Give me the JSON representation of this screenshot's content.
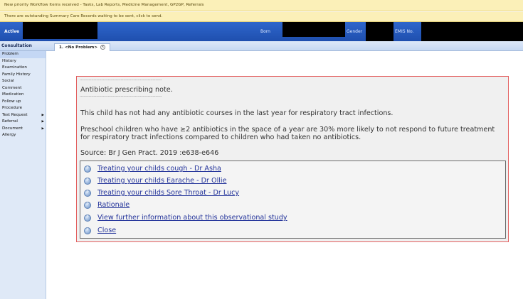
{
  "notifications": {
    "workflow": "New priority Workflow Items received - Tasks, Lab Reports, Medicine Management, GP2GP, Referrals",
    "summary_care": "There are outstanding Summary Care Records waiting to be sent, click to send."
  },
  "patient_bar": {
    "status": "Active",
    "born_label": "Born",
    "gender_label": "Gender",
    "emis_label": "EMIS No."
  },
  "consultation": {
    "title": "Consultation",
    "tab_label": "1. <No Problem>"
  },
  "sidebar": {
    "items": [
      {
        "label": "Problem",
        "has_submenu": false
      },
      {
        "label": "History",
        "has_submenu": false
      },
      {
        "label": "Examination",
        "has_submenu": false
      },
      {
        "label": "Family History",
        "has_submenu": false
      },
      {
        "label": "Social",
        "has_submenu": false
      },
      {
        "label": "Comment",
        "has_submenu": false
      },
      {
        "label": "Medication",
        "has_submenu": false
      },
      {
        "label": "Follow up",
        "has_submenu": false
      },
      {
        "label": "Procedure",
        "has_submenu": false
      },
      {
        "label": "Test Request",
        "has_submenu": true
      },
      {
        "label": "Referral",
        "has_submenu": true
      },
      {
        "label": "Document",
        "has_submenu": true
      },
      {
        "label": "Allergy",
        "has_submenu": false
      }
    ]
  },
  "note": {
    "separator": "----------------------------------------------------------------",
    "title": "Antibiotic prescribing note.",
    "line1": "This child has not had any antibiotic courses in the last year for respiratory tract infections.",
    "line2": "Preschool children who have ≥2 antibiotics in the space of a year are 30% more likely to not respond to future treatment for respiratory tract infections compared to children who had taken no antibiotics.",
    "source": "Source: Br J Gen Pract. 2019 :e638-e646",
    "links": [
      "Treating your childs cough - Dr Asha",
      "Treating your childs Earache - Dr Ollie",
      "Treating your childs Sore Throat - Dr Lucy",
      "Rationale",
      "View further information about this observational study",
      "Close"
    ]
  }
}
